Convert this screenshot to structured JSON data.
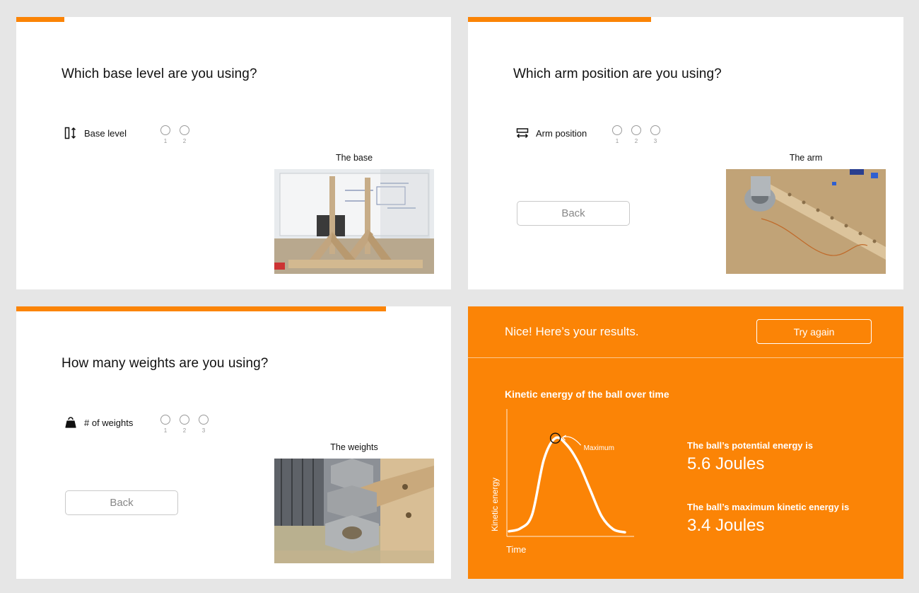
{
  "colors": {
    "accent": "#fb8406",
    "background": "#e6e6e6",
    "panel": "#ffffff"
  },
  "panels": {
    "base": {
      "progress": 0.11,
      "question": "Which base level are you using?",
      "option_icon": "height-adjust-icon",
      "option_label": "Base level",
      "radio_options": [
        "1",
        "2"
      ],
      "photo_caption": "The base"
    },
    "arm": {
      "progress": 0.42,
      "question": "Which arm position are you using?",
      "option_icon": "horizontal-arrows-icon",
      "option_label": "Arm position",
      "radio_options": [
        "1",
        "2",
        "3"
      ],
      "photo_caption": "The arm",
      "back_label": "Back"
    },
    "weights": {
      "progress": 0.85,
      "question": "How many weights are you using?",
      "option_icon": "weight-icon",
      "option_label": "# of weights",
      "radio_options": [
        "1",
        "2",
        "3"
      ],
      "photo_caption": "The weights",
      "back_label": "Back"
    },
    "results": {
      "title": "Nice! Here’s your results.",
      "try_again_label": "Try again",
      "chart_title": "Kinetic energy of the ball over time",
      "potential_label": "The ball’s potential energy is",
      "potential_value": "5.6 Joules",
      "kinetic_label": "The ball’s maximum kinetic energy is",
      "kinetic_value": "3.4 Joules"
    }
  },
  "chart_data": {
    "type": "line",
    "title": "Kinetic energy of the ball over time",
    "xlabel": "Time",
    "ylabel": "Kinetic energy",
    "grid": false,
    "annotations": [
      "Maximum"
    ],
    "series": [
      {
        "x": [
          0,
          0.1,
          0.2,
          0.3,
          0.4,
          0.5,
          0.6,
          0.7,
          0.8,
          0.9,
          1.0
        ],
        "y": [
          0.03,
          0.06,
          0.2,
          0.75,
          0.97,
          0.9,
          0.72,
          0.45,
          0.18,
          0.05,
          0.02
        ]
      }
    ]
  }
}
